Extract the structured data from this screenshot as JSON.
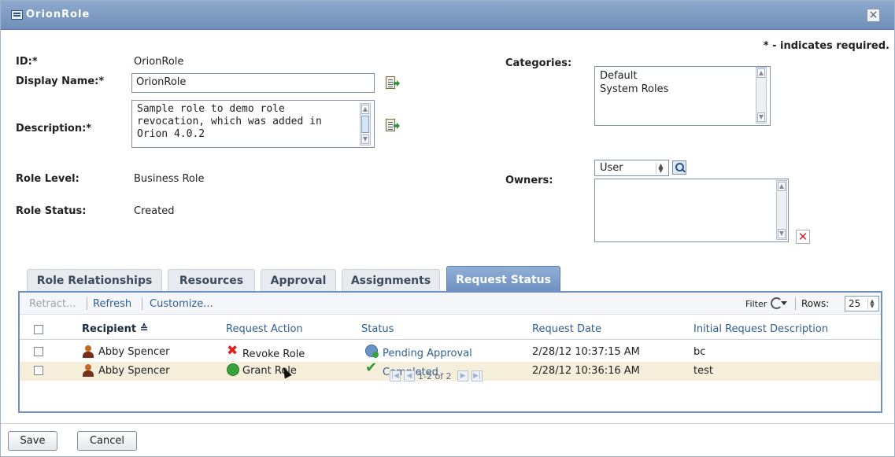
{
  "window": {
    "title": "OrionRole",
    "close_label": "×"
  },
  "required_note": "* - indicates required.",
  "form": {
    "id_label": "ID:*",
    "id_value": "OrionRole",
    "display_name_label": "Display Name:*",
    "display_name_value": "OrionRole",
    "description_label": "Description:*",
    "description_value": "Sample role to demo role\nrevocation, which was added in\nOrion 4.0.2",
    "role_level_label": "Role Level:",
    "role_level_value": "Business Role",
    "role_status_label": "Role Status:",
    "role_status_value": "Created",
    "categories_label": "Categories:",
    "categories": [
      "Default",
      "System Roles"
    ],
    "owners_label": "Owners:",
    "owners_type": "User"
  },
  "tabs": [
    {
      "label": "Role Relationships",
      "active": false
    },
    {
      "label": "Resources",
      "active": false
    },
    {
      "label": "Approval",
      "active": false
    },
    {
      "label": "Assignments",
      "active": false
    },
    {
      "label": "Request Status",
      "active": true
    }
  ],
  "toolbar": {
    "retract": "Retract...",
    "refresh": "Refresh",
    "customize": "Customize...",
    "filter": "Filter",
    "rows_label": "Rows:",
    "rows_value": "25"
  },
  "table": {
    "columns": [
      "Recipient ≙",
      "Request Action",
      "Status",
      "Request Date",
      "Initial Request Description"
    ],
    "rows": [
      {
        "recipient": "Abby Spencer",
        "action": "Revoke Role",
        "status": "Pending Approval",
        "date": "2/28/12 10:37:15 AM",
        "description": "bc"
      },
      {
        "recipient": "Abby Spencer",
        "action": "Grant Role",
        "status": "Completed",
        "date": "2/28/12 10:36:16 AM",
        "description": "test"
      }
    ],
    "pager": "1-2 of 2"
  },
  "buttons": {
    "save": "Save",
    "cancel": "Cancel"
  }
}
